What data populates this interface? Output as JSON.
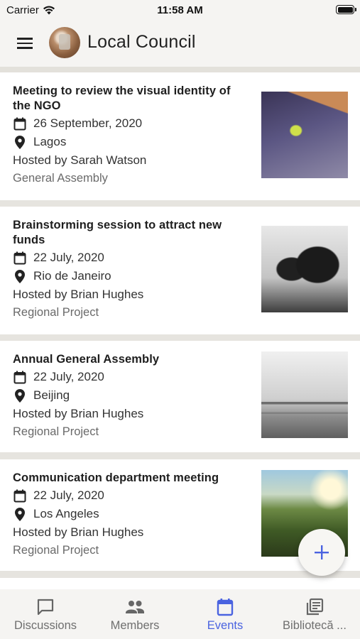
{
  "status_bar": {
    "carrier": "Carrier",
    "time": "11:58 AM"
  },
  "app_bar": {
    "title": "Local Council"
  },
  "events": [
    {
      "title": "Meeting to review the visual identity of the NGO",
      "date": "26 September, 2020",
      "location": "Lagos",
      "host": "Hosted by Sarah Watson",
      "type": "General Assembly"
    },
    {
      "title": "Brainstorming session to attract new funds",
      "date": "22 July, 2020",
      "location": "Rio de Janeiro",
      "host": "Hosted by Brian Hughes",
      "type": "Regional Project"
    },
    {
      "title": "Annual General Assembly",
      "date": "22 July, 2020",
      "location": "Beijing",
      "host": "Hosted by Brian Hughes",
      "type": "Regional Project"
    },
    {
      "title": "Communication department meeting",
      "date": "22 July, 2020",
      "location": "Los Angeles",
      "host": "Hosted by Brian Hughes",
      "type": "Regional Project"
    }
  ],
  "bottom_nav": [
    {
      "label": "Discussions",
      "icon": "chat-icon",
      "active": false
    },
    {
      "label": "Members",
      "icon": "people-icon",
      "active": false
    },
    {
      "label": "Events",
      "icon": "calendar-icon",
      "active": true
    },
    {
      "label": "Bibliotecă ...",
      "icon": "library-icon",
      "active": false
    }
  ],
  "colors": {
    "accent": "#4a63e0",
    "background": "#e6e4df",
    "surface": "#ffffff"
  }
}
